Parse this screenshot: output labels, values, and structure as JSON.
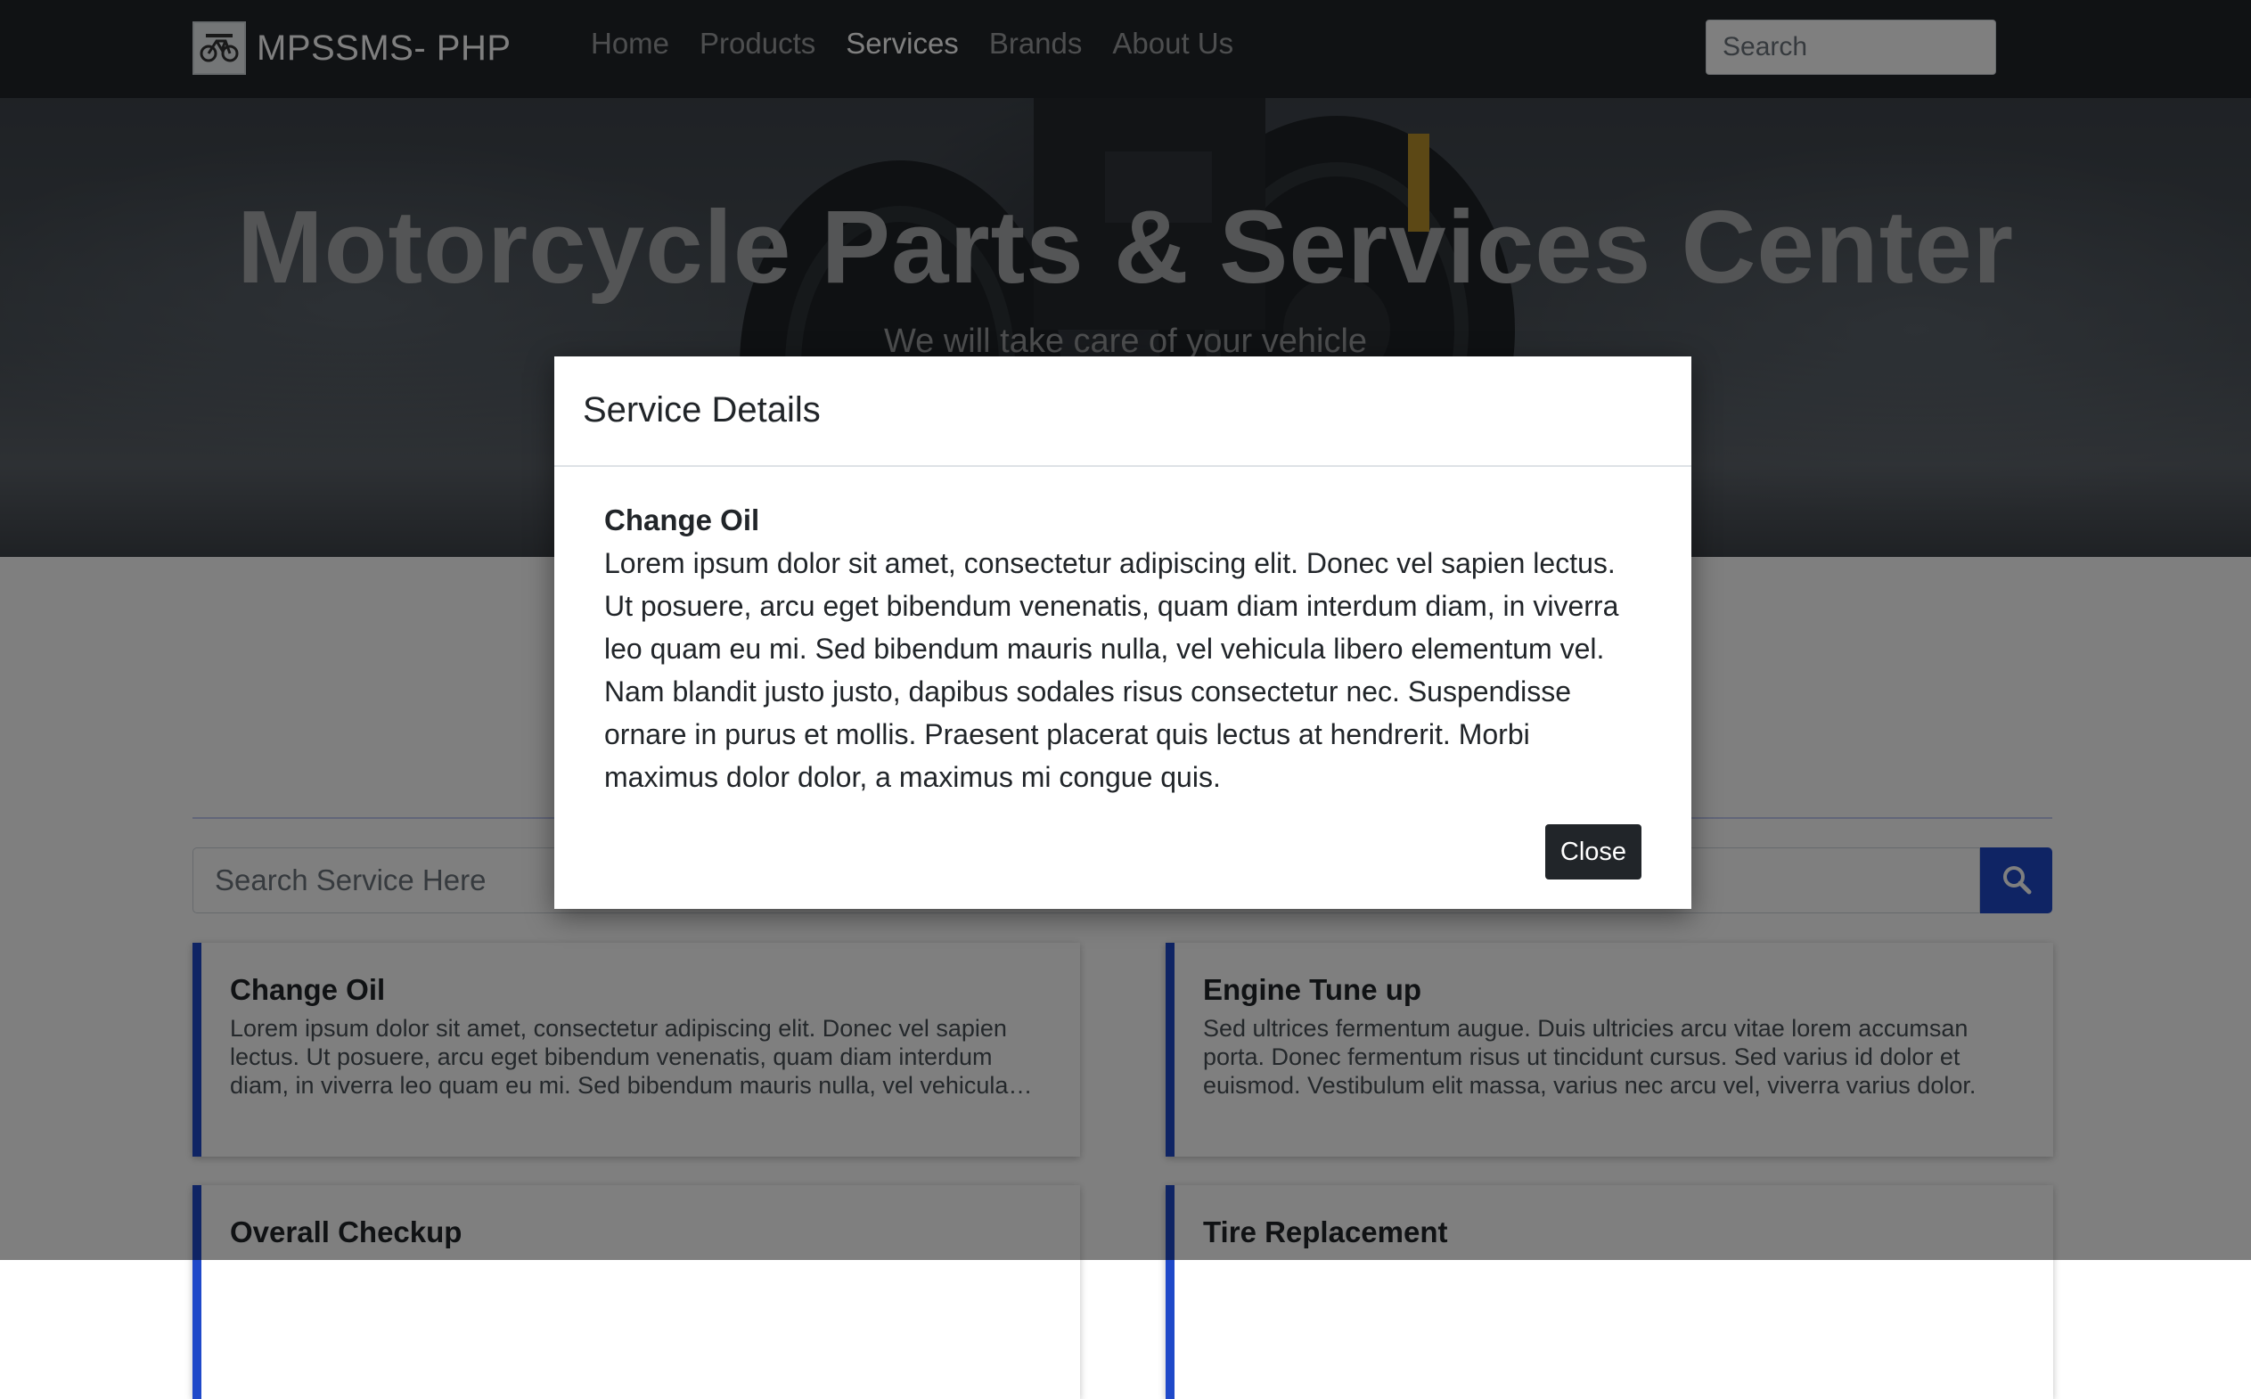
{
  "navbar": {
    "brand_name": "MPSSMS- PHP",
    "links": [
      {
        "label": "Home",
        "active": false
      },
      {
        "label": "Products",
        "active": false
      },
      {
        "label": "Services",
        "active": true
      },
      {
        "label": "Brands",
        "active": false
      },
      {
        "label": "About Us",
        "active": false
      }
    ],
    "search_placeholder": "Search"
  },
  "hero": {
    "title": "Motorcycle Parts & Services Center",
    "subtitle": "We will take care of your vehicle"
  },
  "services_search": {
    "placeholder": "Search Service Here",
    "button_icon": "search-icon"
  },
  "services": [
    {
      "title": "Change Oil",
      "description": "Lorem ipsum dolor sit amet, consectetur adipiscing elit. Donec vel sapien lectus. Ut posuere, arcu eget bibendum venenatis, quam diam interdum diam, in viverra leo quam eu mi. Sed bibendum mauris nulla, vel vehicula libero elementum vel."
    },
    {
      "title": "Engine Tune up",
      "description": "Sed ultrices fermentum augue. Duis ultricies arcu vitae lorem accumsan porta. Donec fermentum risus ut tincidunt cursus. Sed varius id dolor et euismod. Vestibulum elit massa, varius nec arcu vel, viverra varius dolor."
    },
    {
      "title": "Overall Checkup",
      "description": ""
    },
    {
      "title": "Tire Replacement",
      "description": ""
    }
  ],
  "modal": {
    "title": "Service Details",
    "service_title": "Change Oil",
    "service_description": "Lorem ipsum dolor sit amet, consectetur adipiscing elit. Donec vel sapien lectus. Ut posuere, arcu eget bibendum venenatis, quam diam interdum diam, in viverra leo quam eu mi. Sed bibendum mauris nulla, vel vehicula libero elementum vel. Nam blandit justo justo, dapibus sodales risus consectetur nec. Suspendisse ornare in purus et mollis. Praesent placerat quis lectus at hendrerit. Morbi maximus dolor dolor, a maximus mi congue quis.",
    "close_label": "Close"
  },
  "colors": {
    "navbar_bg": "#212529",
    "accent": "#1f49c9",
    "overlay": "rgba(0,0,0,0.5)"
  }
}
